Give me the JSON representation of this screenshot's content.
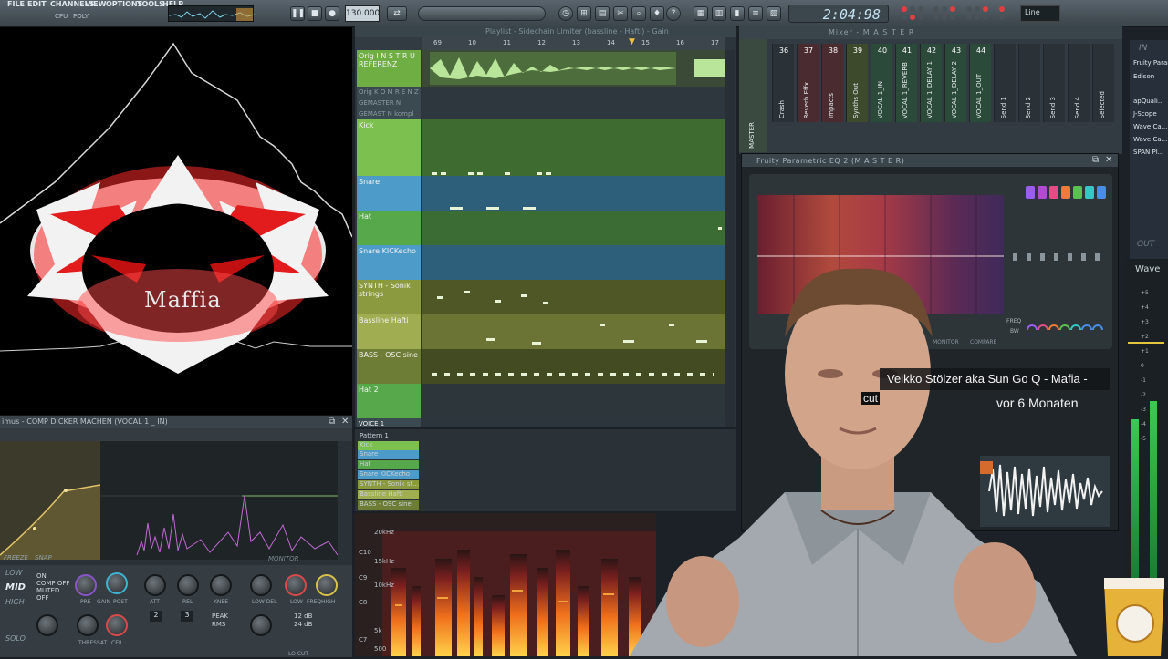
{
  "menu": {
    "file": "FILE",
    "edit": "EDIT",
    "channels": "CHANNELS",
    "view": "VIEW",
    "options": "OPTIONS",
    "tools": "TOOLS",
    "help": "HELP"
  },
  "transport": {
    "time": "2:04:98",
    "tempo": "130.000",
    "line_mode": "Line",
    "hint_cpu": "CPU",
    "hint_poly": "POLY"
  },
  "visualizer": {
    "logo_name": "Maffia"
  },
  "limiter": {
    "title": "imus - COMP DICKER MACHEN (VOCAL 1 _ IN)",
    "options": [
      "ON",
      "COMP OFF",
      "MUTED",
      "OFF"
    ],
    "labels": {
      "freeze": "FREEZE",
      "snap": "SNAP",
      "monitor": "MONITOR"
    },
    "side": [
      "LOW",
      "MID",
      "HIGH",
      "SOLO"
    ],
    "knobs": [
      "PRE",
      "GAIN",
      "POST",
      "ATT",
      "REL",
      "KNEE",
      "LOW DEL",
      "LOW",
      "FREQ",
      "HIGH",
      "THRES",
      "SAT",
      "CEIL"
    ],
    "readouts": [
      "2",
      "3",
      "PEAK",
      "RMS",
      "12 dB",
      "24 dB"
    ],
    "lo_cut": "LO CUT"
  },
  "playlist": {
    "title": "Playlist - Sidechain Limiter (bassline - Hafti) - Gain",
    "ticks": [
      "69",
      "10",
      "11",
      "12",
      "13",
      "14",
      "15",
      "16",
      "17"
    ],
    "tracks": [
      {
        "label": "Orig I N S T R U REFERENZ",
        "color": "#6eae43"
      },
      {
        "label": "Orig K O M  R E N Z",
        "color": "#3b4a50"
      },
      {
        "label": "GEMASTER N Instru",
        "color": "#3b4a50"
      },
      {
        "label": "GEMAST N kompl",
        "color": "#3b4a50"
      },
      {
        "label": "Kick",
        "color": "#7cc04f"
      },
      {
        "label": "Snare",
        "color": "#4d9bc9"
      },
      {
        "label": "Hat",
        "color": "#56a84a"
      },
      {
        "label": "Snare KICKecho",
        "color": "#4d9bc9"
      },
      {
        "label": "SYNTH - Sonik strings",
        "color": "#8b9a3f"
      },
      {
        "label": "Bassline Hafti",
        "color": "#a0ad51"
      },
      {
        "label": "BASS - OSC sine",
        "color": "#6e7d35"
      },
      {
        "label": "Hat 2",
        "color": "#56a84a"
      },
      {
        "label": "VOICE 1",
        "color": "#3b4a50"
      }
    ]
  },
  "patterns": [
    {
      "label": "Pattern 1",
      "color": "#2a3237",
      "fg": "#ffffff"
    },
    {
      "label": "Kick",
      "color": "#7cc04f",
      "fg": "#ffffff"
    },
    {
      "label": "Snare",
      "color": "#4d9bc9",
      "fg": "#ffffff"
    },
    {
      "label": "Hat",
      "color": "#56a84a",
      "fg": "#ffffff"
    },
    {
      "label": "Snare KICKecho",
      "color": "#4d9bc9",
      "fg": "#ffffff"
    },
    {
      "label": "SYNTH - Sonik st...",
      "color": "#8b9a3f",
      "fg": "#ffffff"
    },
    {
      "label": "Bassline Hafti",
      "color": "#a0ad51",
      "fg": "#ffffff"
    },
    {
      "label": "BASS - OSC sine",
      "color": "#6e7d35",
      "fg": "#ffffff"
    }
  ],
  "spectrogram": {
    "labels": [
      "20kHz",
      "15kHz",
      "C10",
      "10kHz",
      "C9",
      "C8",
      "C7",
      "5k",
      "500"
    ]
  },
  "mixer": {
    "title": "Mixer - M A S T E R",
    "master_label": "MASTER",
    "strips": [
      {
        "num": "36",
        "name": "Crash"
      },
      {
        "num": "37",
        "name": "Reverb Effx"
      },
      {
        "num": "38",
        "name": "Impacts"
      },
      {
        "num": "39",
        "name": "Synths Out"
      },
      {
        "num": "40",
        "name": "VOCAL 1_IN"
      },
      {
        "num": "41",
        "name": "VOCAL 1_REVERB"
      },
      {
        "num": "42",
        "name": "VOCAL 1_DELAY 1"
      },
      {
        "num": "43",
        "name": "VOCAL 1_DELAY 2"
      },
      {
        "num": "44",
        "name": "VOCAL 1_OUT"
      },
      {
        "num": "",
        "name": "Send 1"
      },
      {
        "num": "",
        "name": "Send 2"
      },
      {
        "num": "",
        "name": "Send 3"
      },
      {
        "num": "",
        "name": "Send 4"
      },
      {
        "num": "",
        "name": "Selected"
      }
    ]
  },
  "eq": {
    "title": "Fruity Parametric EQ 2 (M A S T E R)",
    "labels": {
      "hq": "HQ",
      "monitor": "MONITOR",
      "compare": "COMPARE",
      "freq": "FREQ",
      "bw": "BW"
    },
    "band_colors": [
      "#9b5cf0",
      "#b24bd4",
      "#e24d86",
      "#f07a3a",
      "#e3c53e",
      "#5ac04f",
      "#33c7c7",
      "#4a8de8"
    ]
  },
  "video": {
    "channel_title": "Veikko Stölzer aka Sun Go Q - Mafia -",
    "time_ago": "vor 6 Monaten",
    "cut_label": "cut"
  },
  "browser": {
    "header_in": "IN",
    "items": [
      "Fruity Parametric",
      "Edison",
      "apQuali...",
      "J-Scope",
      "Wave Ca...",
      "Wave Ca...",
      "SPAN Pl..."
    ],
    "out": "OUT"
  },
  "meter": {
    "label": "Wave",
    "scale": [
      "+5",
      "+4",
      "+3",
      "+2",
      "+1",
      "0",
      "-1",
      "-2",
      "-3",
      "-4",
      "-5"
    ]
  }
}
